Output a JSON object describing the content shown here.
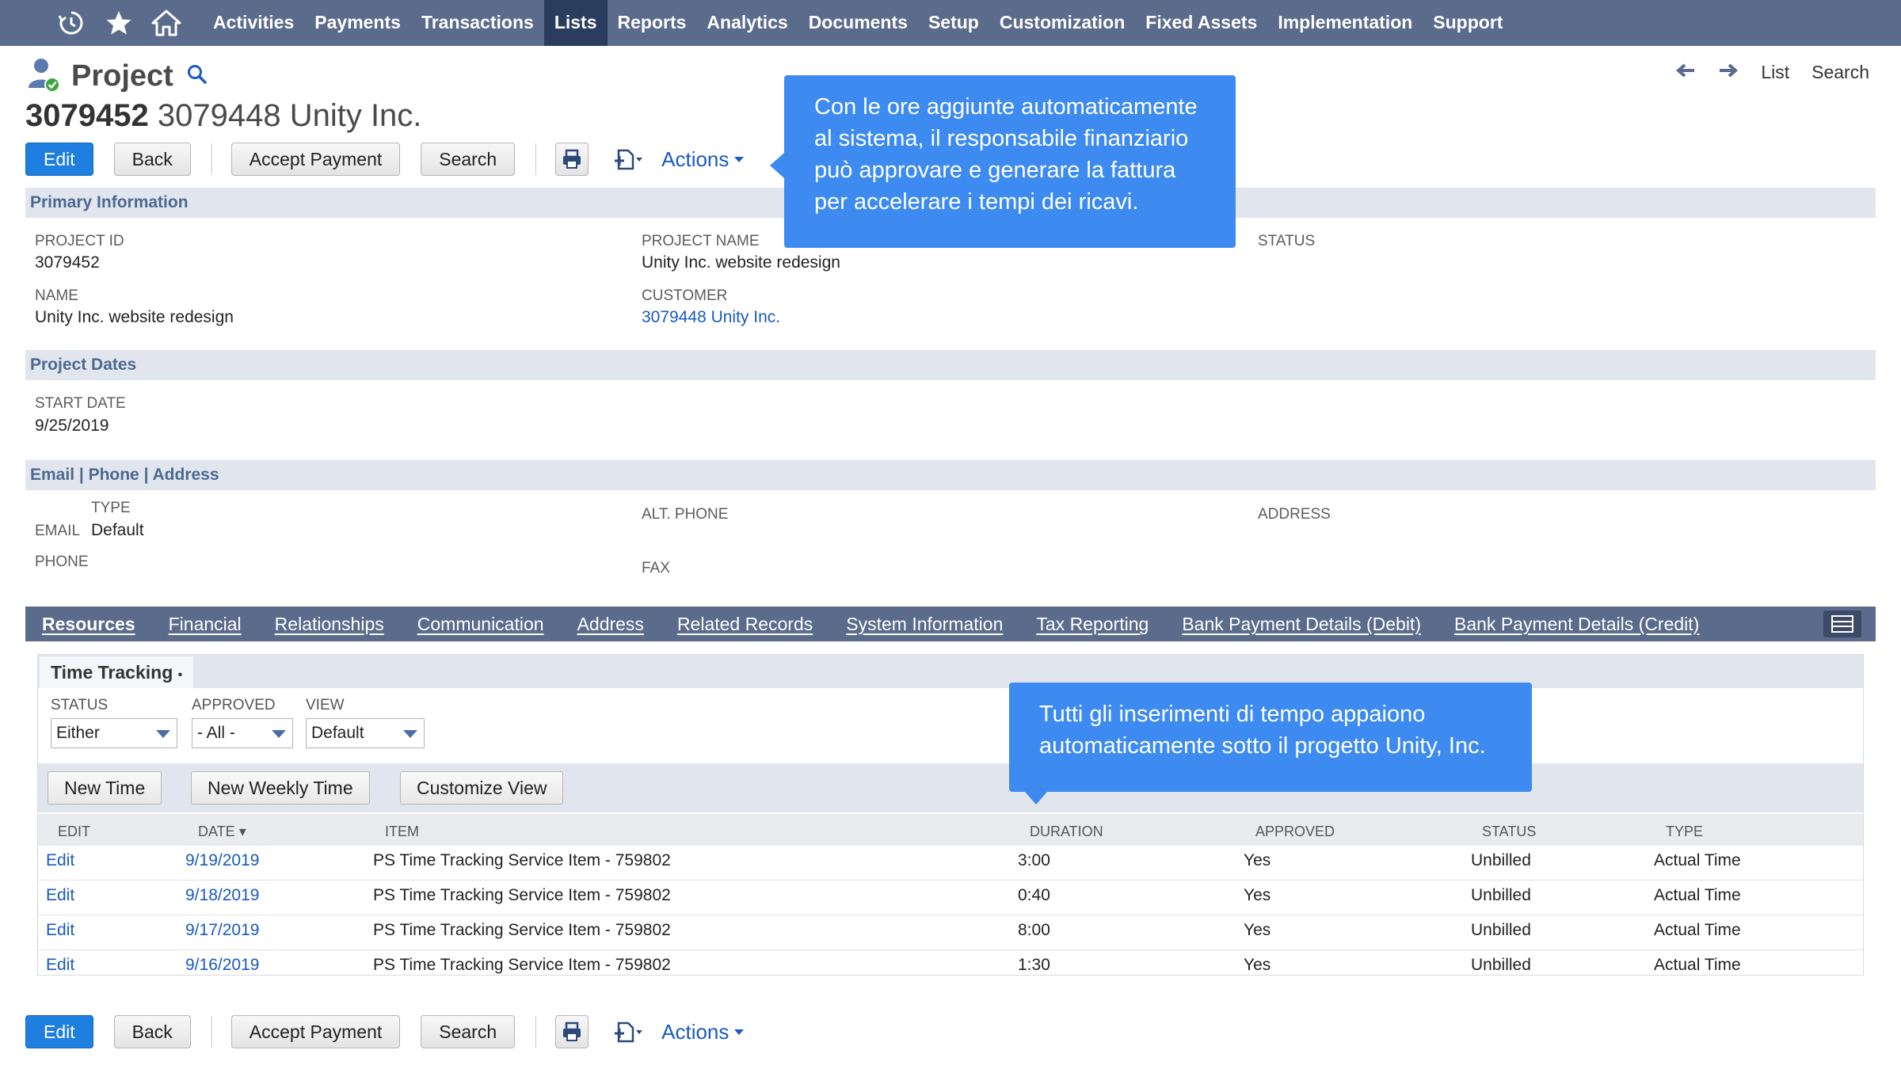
{
  "nav": {
    "menu": [
      "Activities",
      "Payments",
      "Transactions",
      "Lists",
      "Reports",
      "Analytics",
      "Documents",
      "Setup",
      "Customization",
      "Fixed Assets",
      "Implementation",
      "Support"
    ],
    "active": "Lists",
    "icons": [
      "recent-icon",
      "star-icon",
      "home-icon"
    ]
  },
  "header": {
    "title": "Project",
    "record_number": "3079452",
    "record_name": "3079448 Unity Inc.",
    "right_nav": {
      "list": "List",
      "search": "Search"
    }
  },
  "toolbar": {
    "edit": "Edit",
    "back": "Back",
    "accept_payment": "Accept Payment",
    "search": "Search",
    "actions": "Actions"
  },
  "primary": {
    "section": "Primary Information",
    "project_id_label": "Project ID",
    "project_id": "3079452",
    "project_name_label": "Project Name",
    "project_name": "Unity Inc. website redesign",
    "status_label": "Status",
    "name_label": "Name",
    "name": "Unity Inc. website redesign",
    "customer_label": "Customer",
    "customer": "3079448 Unity Inc."
  },
  "dates": {
    "section": "Project Dates",
    "start_label": "Start Date",
    "start": "9/25/2019"
  },
  "contact": {
    "section": "Email | Phone | Address",
    "type_label": "Type",
    "email_label": "Email",
    "type_value": "Default",
    "alt_phone_label": "Alt. Phone",
    "address_label": "Address",
    "phone_label": "Phone",
    "fax_label": "Fax"
  },
  "tabs": [
    "Resources",
    "Financial",
    "Relationships",
    "Communication",
    "Address",
    "Related Records",
    "System Information",
    "Tax Reporting",
    "Bank Payment Details (Debit)",
    "Bank Payment Details (Credit)"
  ],
  "time_tracking": {
    "title": "Time Tracking",
    "title_marker": "•",
    "filters": {
      "status_label": "Status",
      "status": "Either",
      "approved_label": "Approved",
      "approved": "- All -",
      "view_label": "View",
      "view": "Default"
    },
    "buttons": {
      "new_time": "New Time",
      "new_weekly": "New Weekly Time",
      "customize": "Customize View"
    },
    "columns": [
      "Edit",
      "Date",
      "Item",
      "Duration",
      "Approved",
      "Status",
      "Type"
    ],
    "sort_marker": "▾",
    "rows": [
      {
        "edit": "Edit",
        "date": "9/19/2019",
        "item": "PS Time Tracking Service Item - 759802",
        "duration": "3:00",
        "approved": "Yes",
        "status": "Unbilled",
        "type": "Actual Time"
      },
      {
        "edit": "Edit",
        "date": "9/18/2019",
        "item": "PS Time Tracking Service Item - 759802",
        "duration": "0:40",
        "approved": "Yes",
        "status": "Unbilled",
        "type": "Actual Time"
      },
      {
        "edit": "Edit",
        "date": "9/17/2019",
        "item": "PS Time Tracking Service Item - 759802",
        "duration": "8:00",
        "approved": "Yes",
        "status": "Unbilled",
        "type": "Actual Time"
      },
      {
        "edit": "Edit",
        "date": "9/16/2019",
        "item": "PS Time Tracking Service Item - 759802",
        "duration": "1:30",
        "approved": "Yes",
        "status": "Unbilled",
        "type": "Actual Time"
      }
    ]
  },
  "tooltips": {
    "approval": "Con le ore aggiunte automaticamente al sistema, il responsabile finanziario può approvare e generare la fattura per accelerare i tempi dei ricavi.",
    "entries": "Tutti gli inserimenti di tempo appaiono automaticamente sotto il progetto Unity, Inc."
  },
  "colors": {
    "nav": "#5a6b8c",
    "nav_active": "#2b3d5f",
    "primary_button": "#1f7fe0",
    "tooltip": "#3d8bf0",
    "link": "#1a5bbd",
    "section": "#e1e5ee"
  }
}
